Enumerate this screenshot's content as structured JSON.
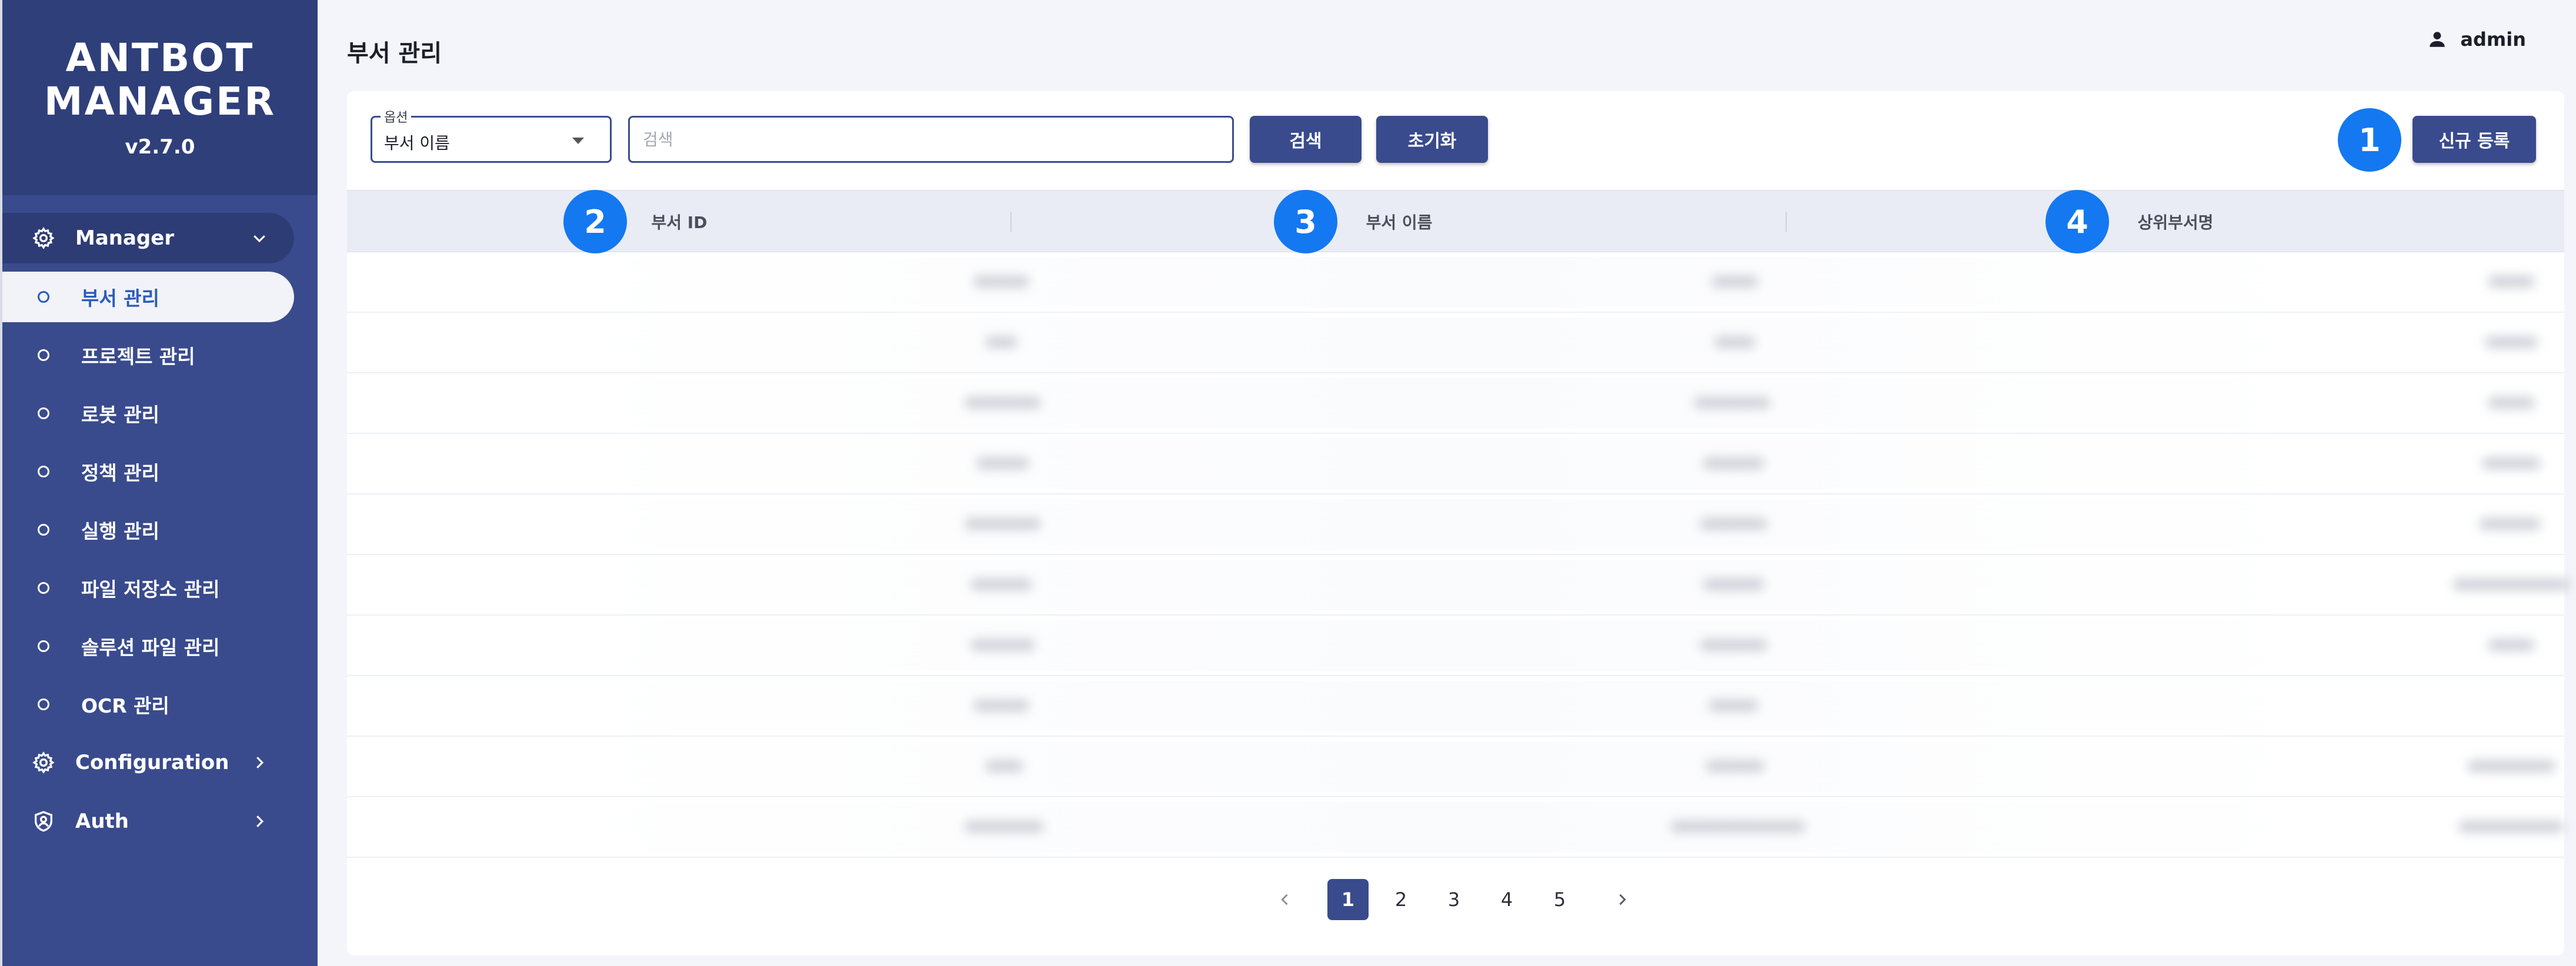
{
  "app": {
    "brand_line1": "ANTBOT",
    "brand_line2": "MANAGER",
    "version": "v2.7.0"
  },
  "sidebar": {
    "groups": [
      {
        "label": "Manager",
        "icon": "gear-icon",
        "expanded": true
      },
      {
        "label": "Configuration",
        "icon": "gear-icon",
        "expanded": false
      },
      {
        "label": "Auth",
        "icon": "shield-user-icon",
        "expanded": false
      }
    ],
    "manager_items": [
      {
        "label": "부서 관리",
        "active": true
      },
      {
        "label": "프로젝트 관리"
      },
      {
        "label": "로봇 관리"
      },
      {
        "label": "정책 관리"
      },
      {
        "label": "실행 관리"
      },
      {
        "label": "파일 저장소 관리"
      },
      {
        "label": "솔루션 파일 관리"
      },
      {
        "label": "OCR 관리"
      }
    ]
  },
  "header": {
    "title": "부서 관리",
    "user": "admin"
  },
  "toolbar": {
    "option_legend": "옵션",
    "option_value": "부서 이름",
    "search_placeholder": "검색",
    "search_label": "검색",
    "reset_label": "초기화",
    "new_label": "신규 등록"
  },
  "badges": [
    "1",
    "2",
    "3",
    "4"
  ],
  "table": {
    "columns": [
      "부서 ID",
      "부서 이름",
      "상위부서명"
    ],
    "row_count": 10,
    "rows_note": "cell values blurred/unreadable in screenshot"
  },
  "pagination": {
    "pages": [
      "1",
      "2",
      "3",
      "4",
      "5"
    ],
    "current": "1"
  },
  "colors": {
    "sidebar": "#394b8c",
    "brand_header": "#2f3f7a",
    "accent_badge": "#1478f0",
    "button": "#394b8c",
    "active_text": "#2b5bb8"
  }
}
